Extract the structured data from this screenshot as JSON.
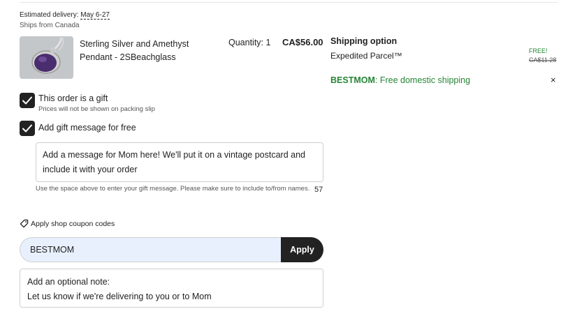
{
  "delivery": {
    "label": "Estimated delivery:",
    "date": "May 6-27",
    "ships_from": "Ships from Canada"
  },
  "item": {
    "image_icon": "amethyst-pendant-photo",
    "title": "Sterling Silver and Amethyst Pendant - 2SBeachglass",
    "quantity": "Quantity: 1",
    "price": "CA$56.00"
  },
  "shipping": {
    "heading": "Shipping option",
    "method": "Expedited Parcel™",
    "free_label": "FREE!",
    "old_price": "CA$11.28",
    "promo_code": "BESTMOM",
    "promo_text": ": Free domestic shipping",
    "close_icon": "×"
  },
  "gift": {
    "checkbox_label": "This order is a gift",
    "checkbox_sub": "Prices will not be shown on packing slip",
    "message_checkbox_label": "Add gift message for free",
    "message_text": "Add a message for Mom here! We'll put it on a vintage postcard and include it with your order",
    "help_text": "Use the space above to enter your gift message. Please make sure to include to/from names.",
    "char_count": "57"
  },
  "coupon": {
    "link_label": "Apply shop coupon codes",
    "icon": "tag-icon",
    "input_value": "BESTMOM",
    "apply_label": "Apply"
  },
  "note": {
    "label": "Add an optional note:",
    "text": "Let us know if we're delivering to you or to Mom"
  },
  "colors": {
    "accent_green": "#258635",
    "button_dark": "#222222",
    "input_fill": "#e8f0fe"
  }
}
